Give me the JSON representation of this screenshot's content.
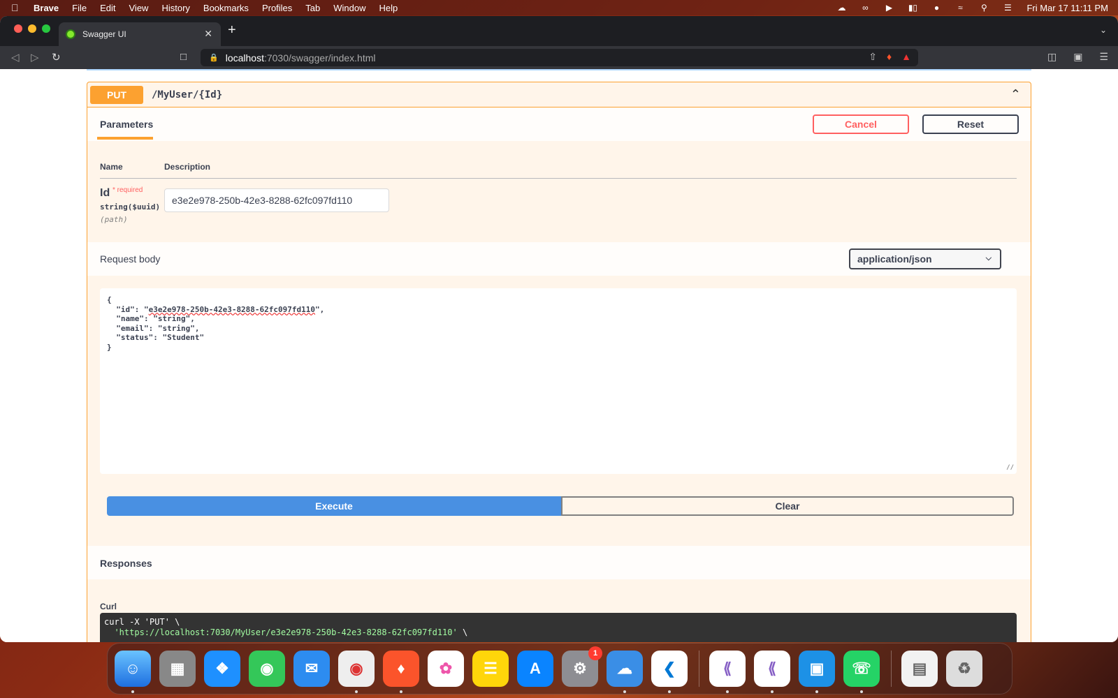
{
  "menubar": {
    "app": "Brave",
    "items": [
      "File",
      "Edit",
      "View",
      "History",
      "Bookmarks",
      "Profiles",
      "Tab",
      "Window",
      "Help"
    ],
    "clock": "Fri Mar 17  11:11 PM"
  },
  "browser": {
    "tab_title": "Swagger UI",
    "url_host": "localhost",
    "url_path": ":7030/swagger/index.html"
  },
  "operation": {
    "method": "PUT",
    "path": "/MyUser/{Id}",
    "section_title": "Parameters",
    "cancel_label": "Cancel",
    "reset_label": "Reset",
    "col_name": "Name",
    "col_description": "Description",
    "param": {
      "name": "Id",
      "required_mark": "* required",
      "type": "string($uuid)",
      "in": "(path)",
      "value": "e3e2e978-250b-42e3-8288-62fc097fd110"
    },
    "request_body_title": "Request body",
    "content_type": "application/json",
    "body_lines": [
      "{",
      "  \"id\": \"",
      "\",",
      "  \"name\": \"string\",",
      "  \"email\": \"string\",",
      "  \"status\": \"Student\"",
      "}"
    ],
    "body_id_value": "e3e2e978-250b-42e3-8288-62fc097fd110",
    "execute_label": "Execute",
    "clear_label": "Clear",
    "responses_title": "Responses",
    "curl_label": "Curl",
    "curl_line1": "curl -X 'PUT' \\",
    "curl_line2_url": "  'https://localhost:7030/MyUser/e3e2e978-250b-42e3-8288-62fc097fd110'",
    "curl_line2_tail": " \\"
  },
  "dock": {
    "badge_count": "1"
  },
  "colors": {
    "put": "#fca130",
    "execute": "#4990e2",
    "cancel": "#ff6060"
  }
}
